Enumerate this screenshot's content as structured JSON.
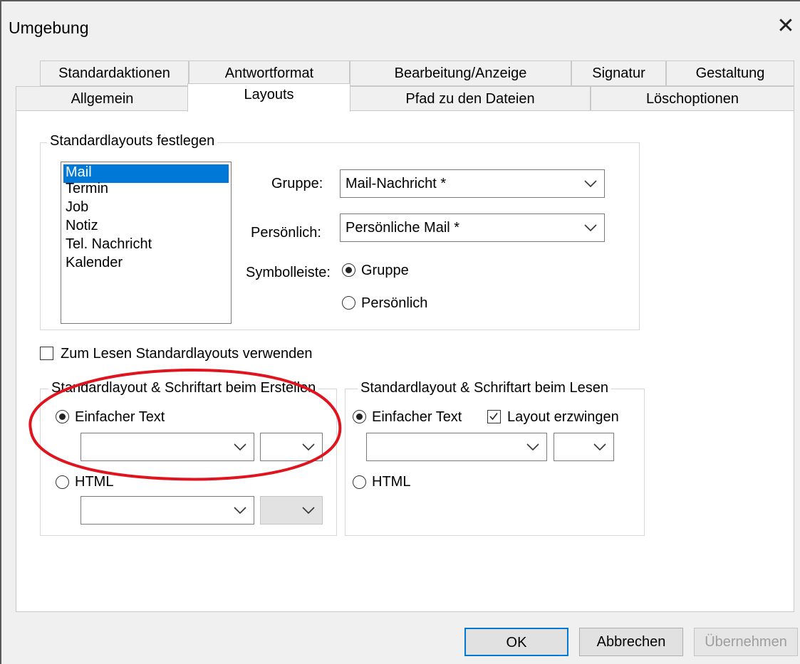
{
  "window": {
    "title": "Umgebung",
    "close_symbol": "✕"
  },
  "tabs": {
    "row1": [
      "Standardaktionen",
      "Antwortformat",
      "Bearbeitung/Anzeige",
      "Signatur",
      "Gestaltung"
    ],
    "row2": [
      "Allgemein",
      "Layouts",
      "Pfad zu den Dateien",
      "Löschoptionen"
    ],
    "active": "Layouts"
  },
  "defaults_group": {
    "title": "Standardlayouts festlegen",
    "list_items": [
      "Mail",
      "Termin",
      "Job",
      "Notiz",
      "Tel. Nachricht",
      "Kalender"
    ],
    "selected_item": "Mail",
    "group_label": "Gruppe:",
    "group_value": "Mail-Nachricht *",
    "personal_label": "Persönlich:",
    "personal_value": "Persönliche Mail *",
    "toolbar_label": "Symbolleiste:",
    "toolbar_option_group": "Gruppe",
    "toolbar_option_personal": "Persönlich",
    "toolbar_selected": "Gruppe"
  },
  "read_defaults_checkbox": {
    "label": "Zum Lesen Standardlayouts verwenden",
    "checked": false
  },
  "create_group": {
    "title": "Standardlayout & Schriftart beim Erstellen",
    "plain_text_label": "Einfacher Text",
    "html_label": "HTML",
    "selected": "Einfacher Text"
  },
  "read_group": {
    "title": "Standardlayout & Schriftart beim Lesen",
    "plain_text_label": "Einfacher Text",
    "force_layout_label": "Layout erzwingen",
    "force_layout_checked": true,
    "html_label": "HTML",
    "selected": "Einfacher Text"
  },
  "buttons": {
    "ok": "OK",
    "cancel": "Abbrechen",
    "apply": "Übernehmen"
  },
  "colors": {
    "selection": "#0078d7",
    "annotation": "#e0141e"
  }
}
